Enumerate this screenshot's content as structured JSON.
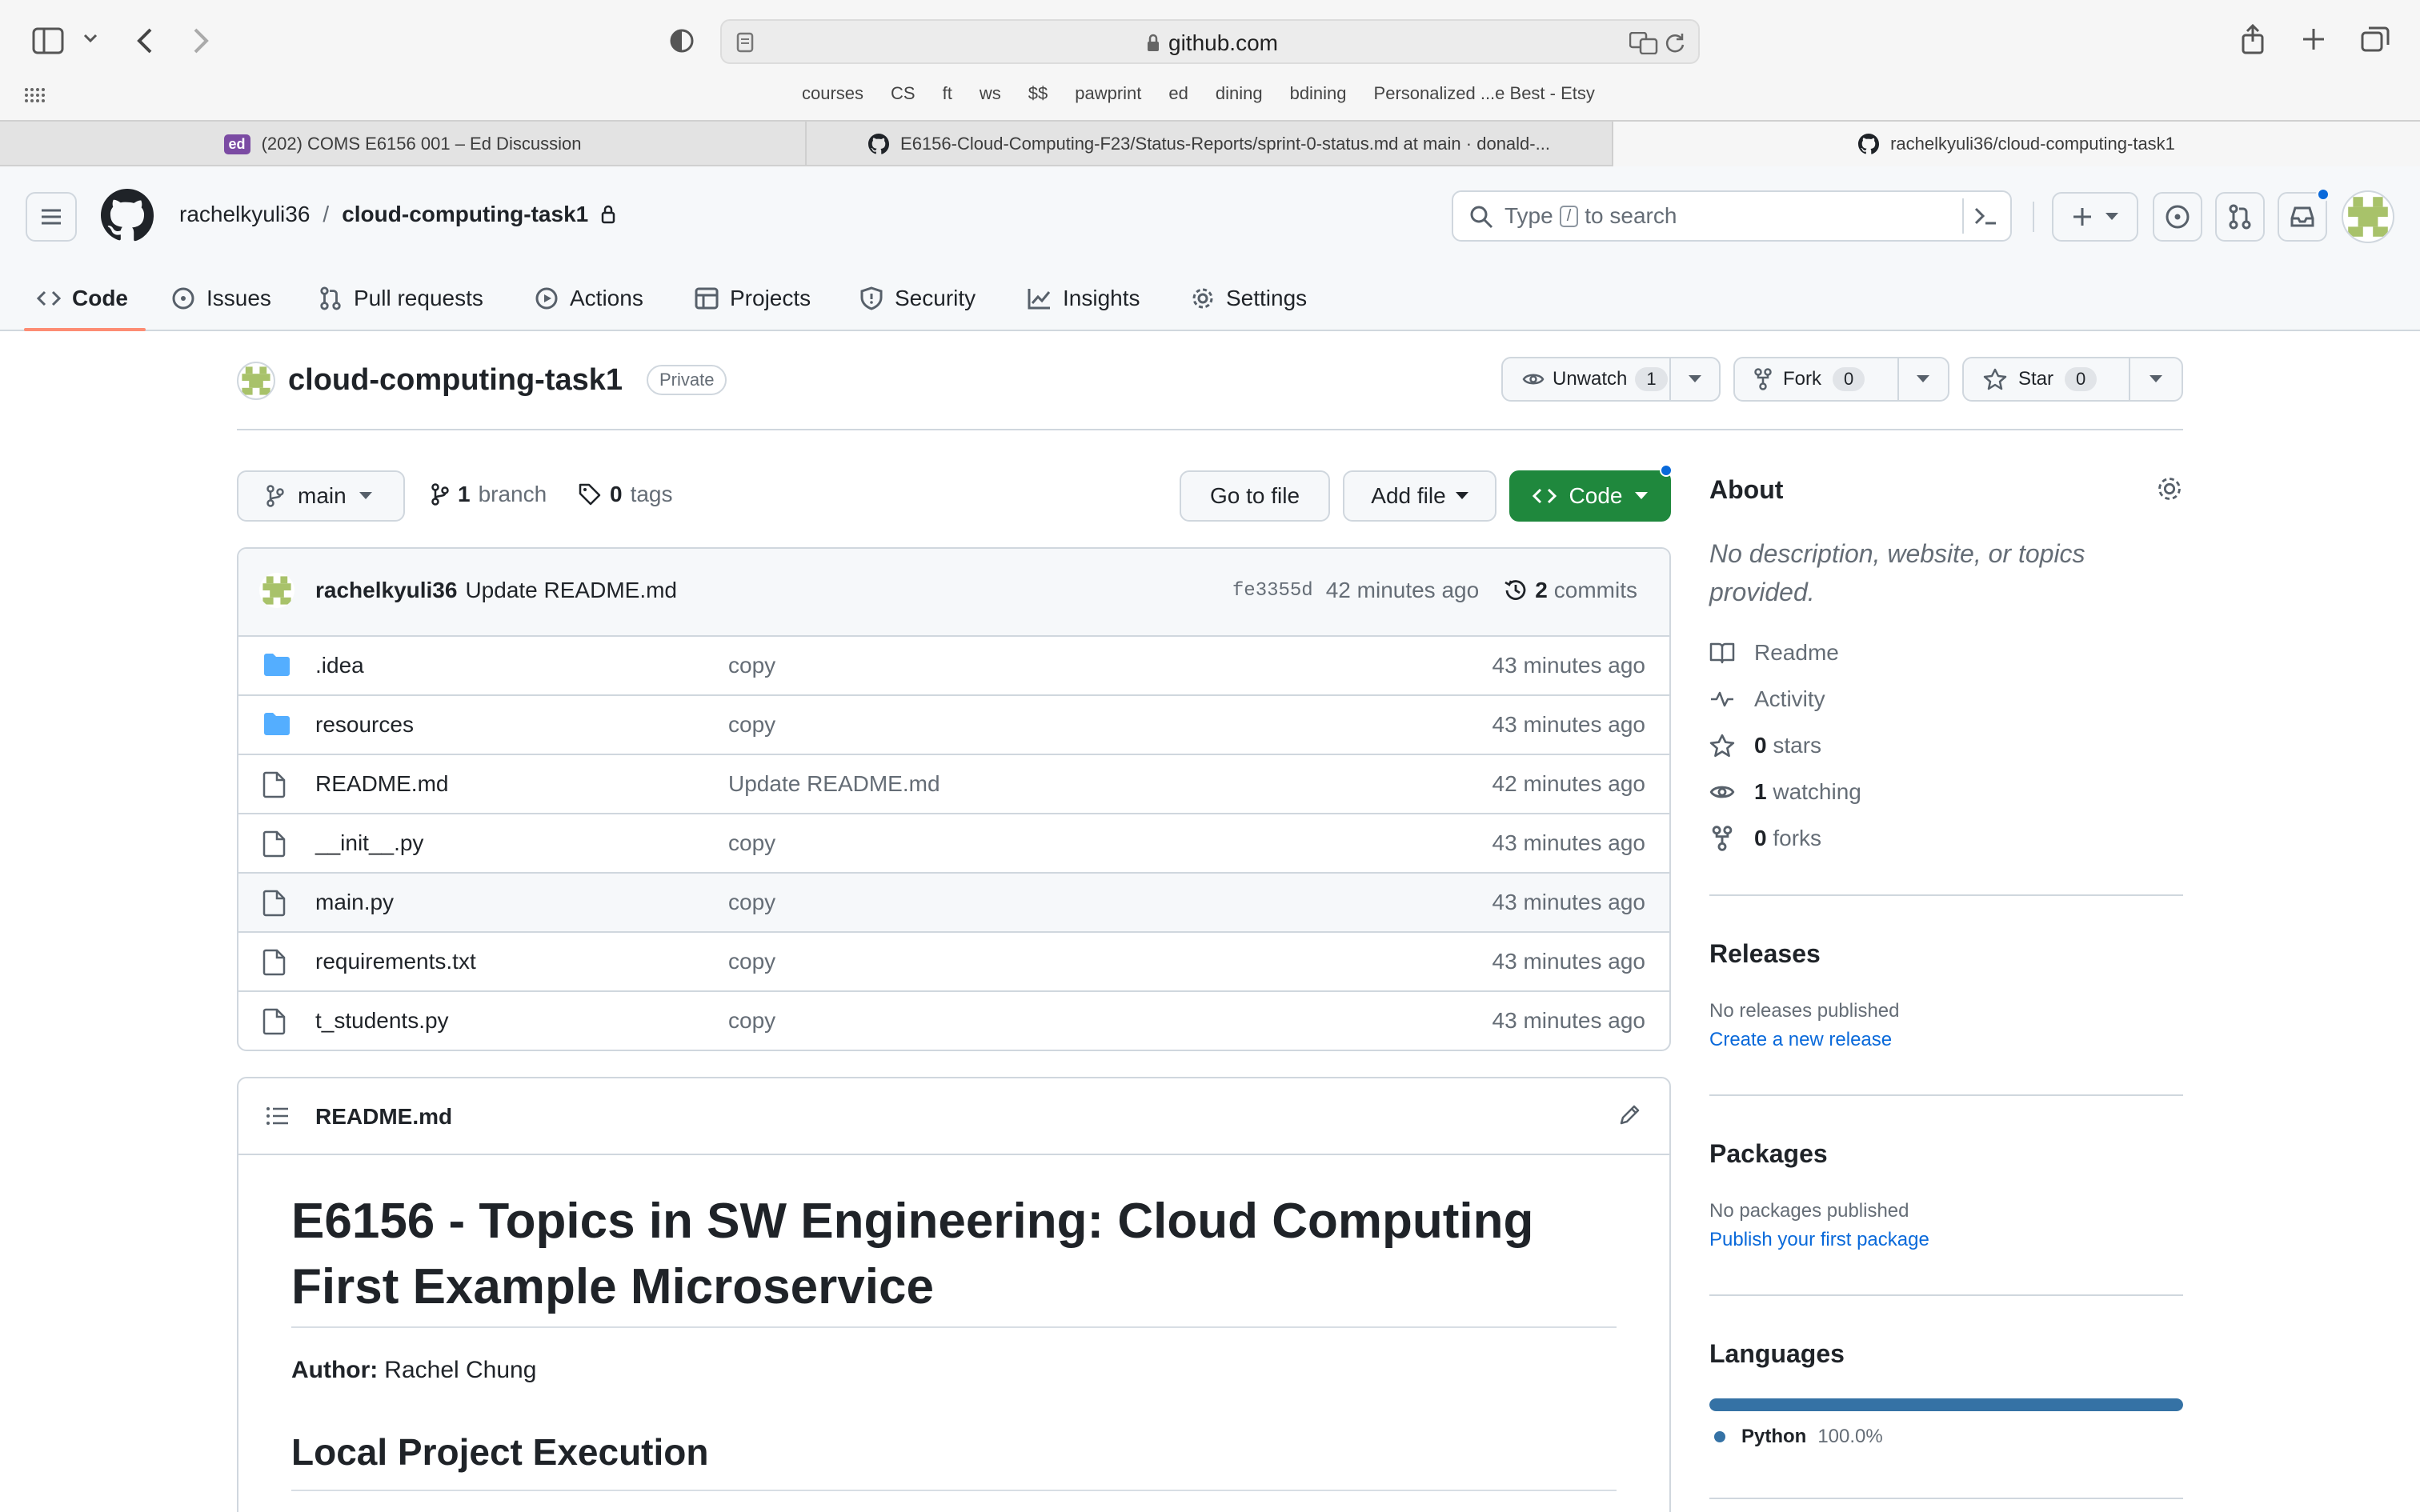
{
  "browser": {
    "url": "github.com",
    "bookmarks": [
      "courses",
      "CS",
      "ft",
      "ws",
      "$$",
      "pawprint",
      "ed",
      "dining",
      "bdining",
      "Personalized ...e Best - Etsy"
    ],
    "tabs": [
      {
        "favicon": "ed",
        "label": "(202) COMS E6156 001 – Ed Discussion"
      },
      {
        "favicon": "github-icon",
        "label": "E6156-Cloud-Computing-F23/Status-Reports/sprint-0-status.md at main · donald-..."
      },
      {
        "favicon": "github-icon",
        "label": "rachelkyuli36/cloud-computing-task1"
      }
    ]
  },
  "header": {
    "owner": "rachelkyuli36",
    "separator": "/",
    "repo": "cloud-computing-task1",
    "search_prefix": "Type",
    "search_key": "/",
    "search_suffix": "to search",
    "nav": [
      "Code",
      "Issues",
      "Pull requests",
      "Actions",
      "Projects",
      "Security",
      "Insights",
      "Settings"
    ]
  },
  "repo": {
    "name": "cloud-computing-task1",
    "visibility": "Private",
    "unwatch_label": "Unwatch",
    "unwatch_count": "1",
    "fork_label": "Fork",
    "fork_count": "0",
    "star_label": "Star",
    "star_count": "0"
  },
  "toolbar": {
    "branch": "main",
    "branch_count": "1",
    "branch_label": "branch",
    "tag_count": "0",
    "tag_label": "tags",
    "go_to_file": "Go to file",
    "add_file": "Add file",
    "code": "Code"
  },
  "commit": {
    "author": "rachelkyuli36",
    "message": "Update README.md",
    "hash": "fe3355d",
    "age": "42 minutes ago",
    "count": "2",
    "count_label": "commits"
  },
  "files": [
    {
      "name": ".idea",
      "type": "folder",
      "message": "copy",
      "age": "43 minutes ago"
    },
    {
      "name": "resources",
      "type": "folder",
      "message": "copy",
      "age": "43 minutes ago"
    },
    {
      "name": "README.md",
      "type": "file",
      "message": "Update README.md",
      "age": "42 minutes ago"
    },
    {
      "name": "__init__.py",
      "type": "file",
      "message": "copy",
      "age": "43 minutes ago"
    },
    {
      "name": "main.py",
      "type": "file",
      "message": "copy",
      "age": "43 minutes ago"
    },
    {
      "name": "requirements.txt",
      "type": "file",
      "message": "copy",
      "age": "43 minutes ago"
    },
    {
      "name": "t_students.py",
      "type": "file",
      "message": "copy",
      "age": "43 minutes ago"
    }
  ],
  "readme": {
    "filename": "README.md",
    "h1_line1": "E6156 - Topics in SW Engineering: Cloud Computing",
    "h1_line2": "First Example Microservice",
    "author_label": "Author:",
    "author_name": "Rachel Chung",
    "h2": "Local Project Execution"
  },
  "about": {
    "title": "About",
    "description_line1": "No description, website, or topics",
    "description_line2": "provided.",
    "readme": "Readme",
    "activity": "Activity",
    "stars_count": "0",
    "stars_label": "stars",
    "watching_count": "1",
    "watching_label": "watching",
    "forks_count": "0",
    "forks_label": "forks"
  },
  "releases": {
    "title": "Releases",
    "empty": "No releases published",
    "link": "Create a new release"
  },
  "packages": {
    "title": "Packages",
    "empty": "No packages published",
    "link": "Publish your first package"
  },
  "languages": {
    "title": "Languages",
    "name": "Python",
    "percent": "100.0%",
    "percent_value": 100,
    "color": "#3572A5"
  },
  "colors": {
    "primary_green": "#1f883d",
    "link": "#0969da",
    "nav_underline": "#fd8c73",
    "folder": "#54aeff"
  }
}
